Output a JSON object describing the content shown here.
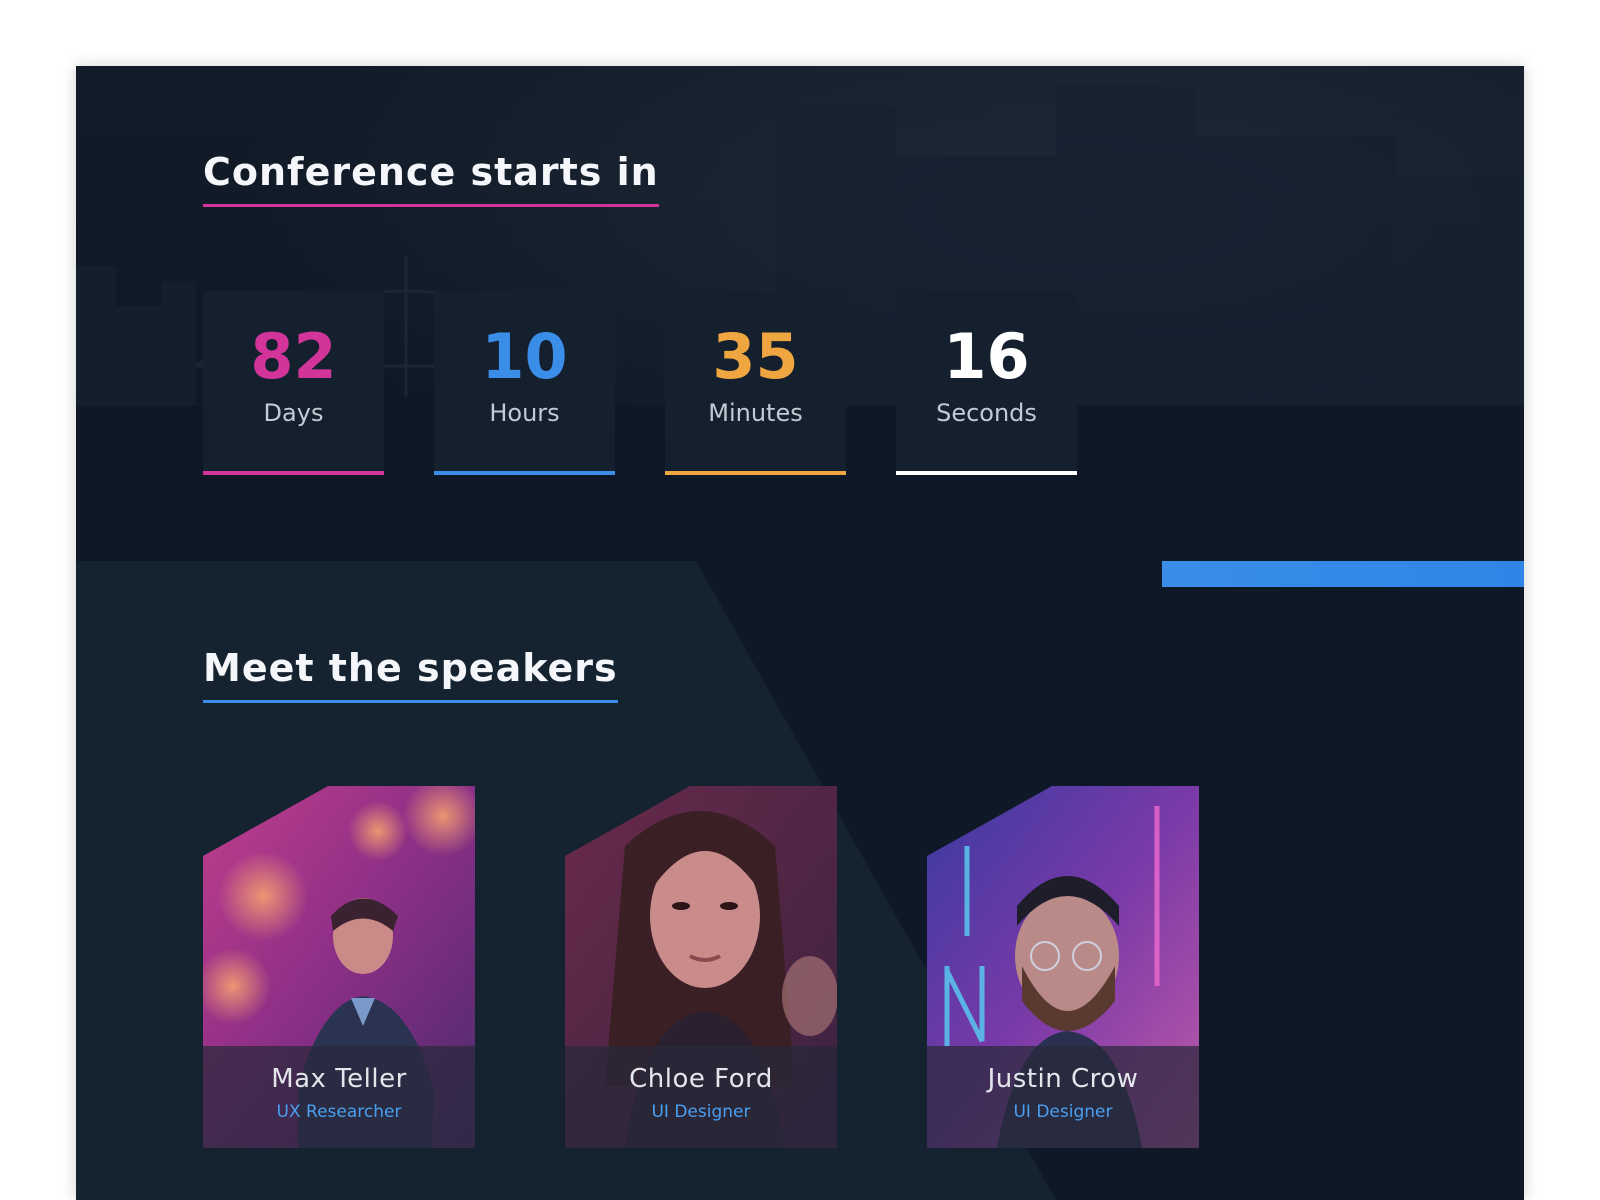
{
  "countdown": {
    "title": "Conference starts in",
    "items": [
      {
        "value": "82",
        "unit": "Days",
        "color": "#d2349a"
      },
      {
        "value": "10",
        "unit": "Hours",
        "color": "#3a8ee8"
      },
      {
        "value": "35",
        "unit": "Minutes",
        "color": "#f0a640"
      },
      {
        "value": "16",
        "unit": "Seconds",
        "color": "#ffffff"
      }
    ]
  },
  "speakers": {
    "title": "Meet the speakers",
    "items": [
      {
        "name": "Max Teller",
        "role": "UX Researcher"
      },
      {
        "name": "Chloe Ford",
        "role": "UI Designer"
      },
      {
        "name": "Justin Crow",
        "role": "UI Designer"
      }
    ]
  },
  "colors": {
    "background": "#0e1826",
    "panel": "#15202e",
    "accent_pink": "#d2349a",
    "accent_blue": "#3a8ee8",
    "accent_orange": "#f0a640"
  }
}
